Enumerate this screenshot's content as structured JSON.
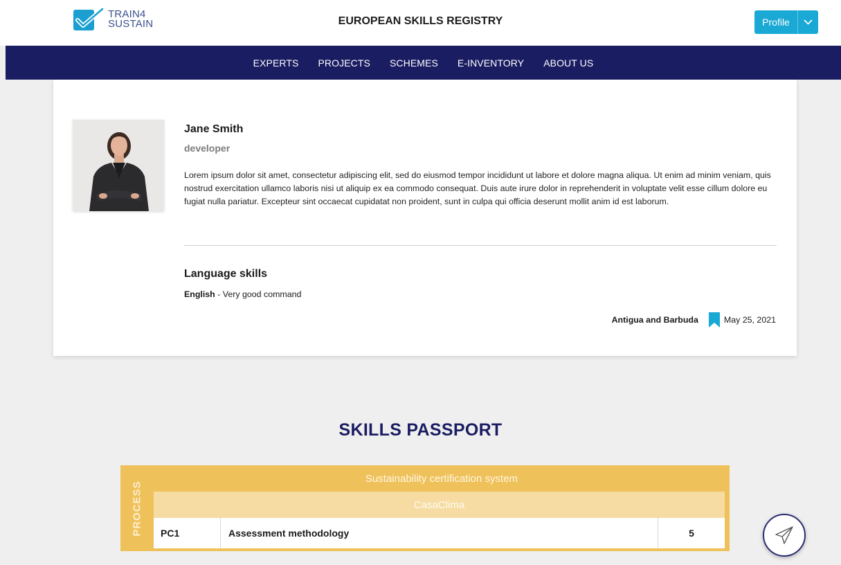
{
  "header": {
    "logo_line1": "TRAIN4",
    "logo_line2": "SUSTAIN",
    "title": "EUROPEAN SKILLS REGISTRY",
    "profile_label": "Profile"
  },
  "nav": {
    "items": [
      "EXPERTS",
      "PROJECTS",
      "SCHEMES",
      "E-INVENTORY",
      "ABOUT US"
    ]
  },
  "profile": {
    "name": "Jane Smith",
    "role": "developer",
    "bio": "Lorem ipsum dolor sit amet, consectetur adipiscing elit, sed do eiusmod tempor incididunt ut labore et dolore magna aliqua. Ut enim ad minim veniam, quis nostrud exercitation ullamco laboris nisi ut aliquip ex ea commodo consequat. Duis aute irure dolor in reprehenderit in voluptate velit esse cillum dolore eu fugiat nulla pariatur. Excepteur sint occaecat cupidatat non proident, sunt in culpa qui officia deserunt mollit anim id est laborum.",
    "language_heading": "Language skills",
    "languages": [
      {
        "language": "English",
        "separator": " - ",
        "level": "Very good command"
      }
    ],
    "country": "Antigua and Barbuda",
    "date": "May 25, 2021"
  },
  "passport": {
    "title": "SKILLS PASSPORT",
    "process_label": "PROCESS",
    "scheme": "Sustainability certification system",
    "system": "CasaClima",
    "rows": [
      {
        "code": "PC1",
        "name": "Assessment methodology",
        "score": "5"
      }
    ]
  },
  "colors": {
    "nav_bg": "#1b1d63",
    "accent": "#1aa8d4",
    "passport_gold": "#efc15a",
    "passport_light": "#f6dca2"
  },
  "icons": [
    "logo-checkmark-icon",
    "chevron-down-icon",
    "bookmark-icon",
    "paper-plane-icon"
  ]
}
